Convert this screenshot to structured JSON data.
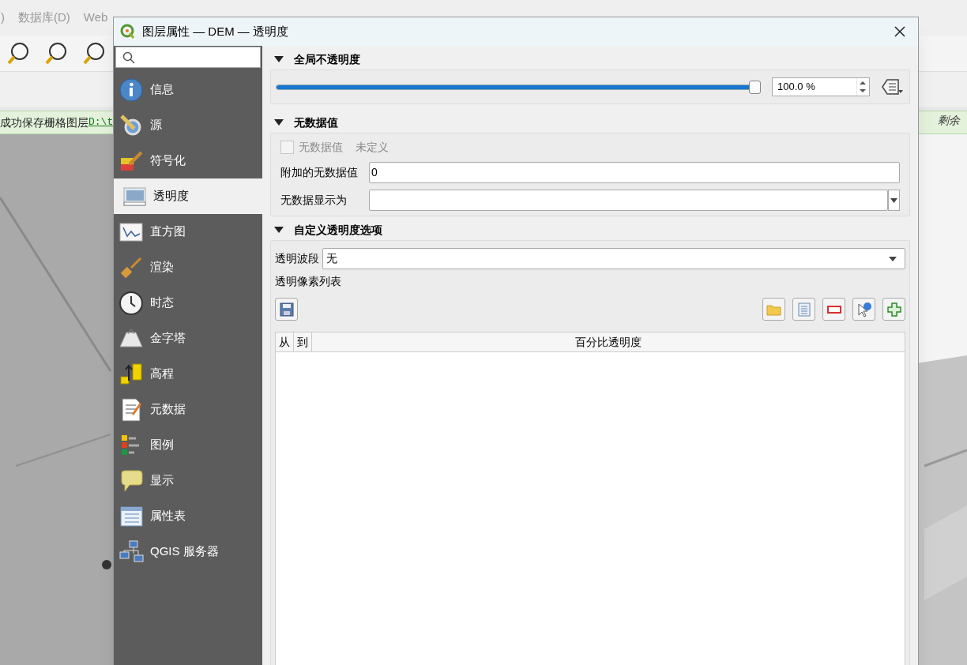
{
  "main_window": {
    "menu": [
      ")",
      "数据库(D)",
      "Web"
    ],
    "message_bar": {
      "text": "成功保存栅格图层",
      "link": "D:\\t",
      "remaining": "剩余"
    }
  },
  "dialog": {
    "title": "图层属性 — DEM — 透明度",
    "sidebar": [
      {
        "label": "信息",
        "selected": false
      },
      {
        "label": "源",
        "selected": false
      },
      {
        "label": "符号化",
        "selected": false
      },
      {
        "label": "透明度",
        "selected": true
      },
      {
        "label": "直方图",
        "selected": false
      },
      {
        "label": "渲染",
        "selected": false
      },
      {
        "label": "时态",
        "selected": false
      },
      {
        "label": "金字塔",
        "selected": false
      },
      {
        "label": "高程",
        "selected": false
      },
      {
        "label": "元数据",
        "selected": false
      },
      {
        "label": "图例",
        "selected": false
      },
      {
        "label": "显示",
        "selected": false
      },
      {
        "label": "属性表",
        "selected": false
      },
      {
        "label": "QGIS 服务器",
        "selected": false
      }
    ],
    "global_opacity": {
      "title": "全局不透明度",
      "expanded": true,
      "slider": {
        "level": 1.0
      },
      "value": "100.0 %"
    },
    "no_data": {
      "title": "无数据值",
      "expanded": true,
      "checkbox": {
        "label": "无数据值",
        "checked": false,
        "disabled": true
      },
      "status": "未定义",
      "additional": {
        "label": "附加的无数据值",
        "value": "0"
      },
      "display_as": {
        "label": "无数据显示为"
      }
    },
    "custom": {
      "title": "自定义透明度选项",
      "expanded": true,
      "band": {
        "label": "透明波段",
        "value": "无"
      },
      "list_label": "透明像素列表",
      "table": {
        "columns": [
          "从",
          "到",
          "百分比透明度"
        ]
      }
    }
  }
}
